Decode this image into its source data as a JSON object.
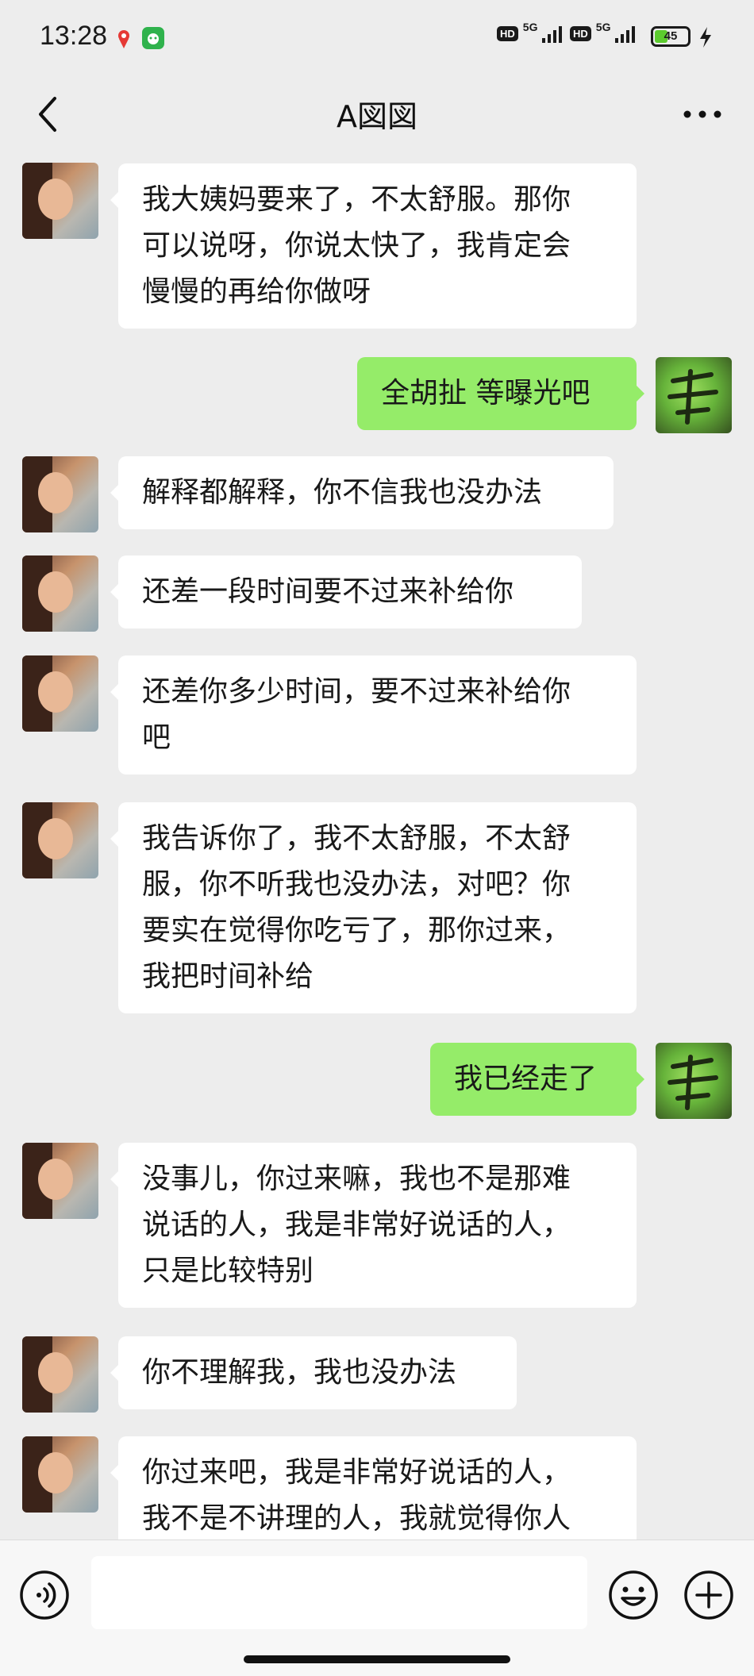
{
  "status_bar": {
    "time": "13:28",
    "app_icons": [
      "location-pin-app-icon",
      "green-app-icon"
    ],
    "network1": {
      "hd": "HD",
      "tech": "5G"
    },
    "network2": {
      "hd": "HD",
      "tech": "5G"
    },
    "battery_level": "45",
    "charging_icon": "bolt-icon"
  },
  "header": {
    "title": "A図図",
    "back_icon": "chevron-left-icon",
    "more_icon": "more-dots-icon"
  },
  "messages": [
    {
      "side": "in",
      "lines": [
        "我大姨妈要来了，不太舒服。那你",
        "可以说呀，你说太快了，我肯定会",
        "慢慢的再给你做呀"
      ]
    },
    {
      "side": "out",
      "lines": [
        "全胡扯 等曝光吧"
      ]
    },
    {
      "side": "in",
      "lines": [
        "解释都解释，你不信我也没办法"
      ]
    },
    {
      "side": "in",
      "lines": [
        "还差一段时间要不过来补给你"
      ]
    },
    {
      "side": "in",
      "lines": [
        "还差你多少时间，要不过来补给你",
        "吧"
      ]
    },
    {
      "side": "in",
      "lines": [
        "我告诉你了，我不太舒服，不太舒",
        "服，你不听我也没办法，对吧？你",
        "要实在觉得你吃亏了，那你过来，",
        "我把时间补给"
      ]
    },
    {
      "side": "out",
      "lines": [
        "我已经走了"
      ]
    },
    {
      "side": "in",
      "lines": [
        "没事儿，你过来嘛，我也不是那难",
        "说话的人，我是非常好说话的人，",
        "只是比较特别"
      ]
    },
    {
      "side": "in",
      "lines": [
        "你不理解我，我也没办法"
      ]
    },
    {
      "side": "in",
      "lines": [
        "你过来吧，我是非常好说话的人，",
        "我不是不讲理的人，我就觉得你人"
      ]
    }
  ],
  "input_bar": {
    "voice_icon": "voice-icon",
    "emoji_icon": "emoji-icon",
    "plus_icon": "plus-icon",
    "message_value": ""
  },
  "colors": {
    "background": "#ededed",
    "incoming_bubble": "#ffffff",
    "outgoing_bubble": "#95ec69",
    "battery_fill": "#5ccb2e"
  }
}
